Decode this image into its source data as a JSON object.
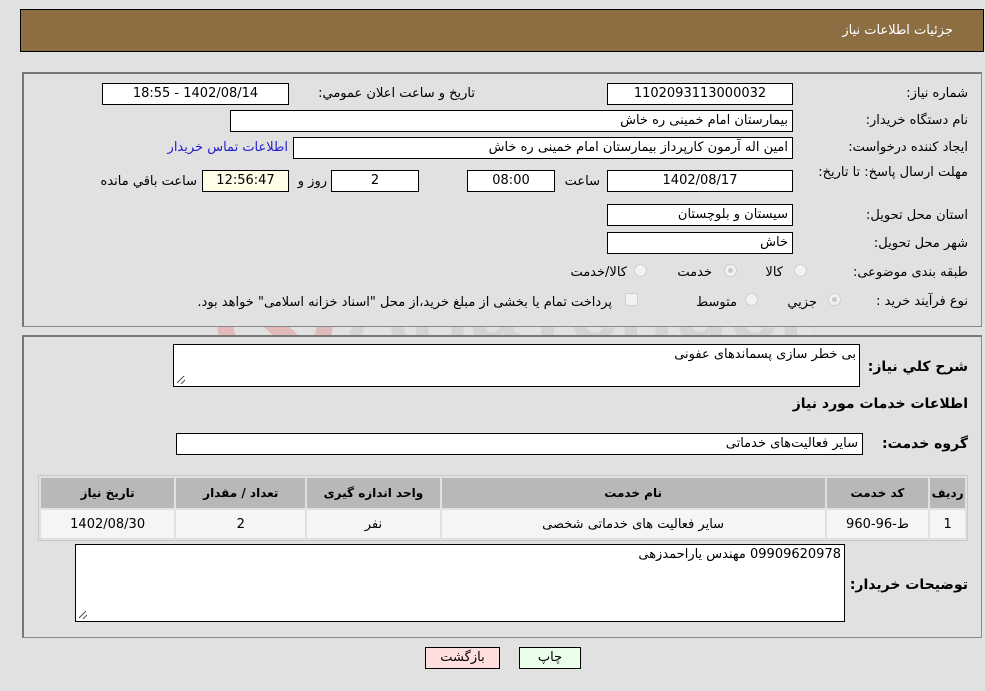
{
  "header": {
    "title": "جزئیات اطلاعات نیاز"
  },
  "form": {
    "need_number": {
      "label": "شماره نیاز:",
      "value": "1102093113000032"
    },
    "announce_datetime": {
      "label": "تاریخ و ساعت اعلان عمومي:",
      "value": "1402/08/14 - 18:55"
    },
    "buyer_org": {
      "label": "نام دستگاه خریدار:",
      "value": "بیمارستان امام خمینی  ره  خاش"
    },
    "requester": {
      "label": "ایجاد کننده درخواست:",
      "value": "امین اله آرمون کارپرداز بیمارستان امام خمینی  ره  خاش"
    },
    "contact_link": "اطلاعات تماس خریدار",
    "deadline": {
      "label": "مهلت ارسال پاسخ: تا تاریخ:",
      "date": "1402/08/17",
      "time_label": "ساعت",
      "time": "08:00",
      "days": "2",
      "days_label": "روز و",
      "remaining": "12:56:47",
      "remaining_label": "ساعت باقي مانده"
    },
    "province": {
      "label": "استان محل تحویل:",
      "value": "سیستان و بلوچستان"
    },
    "city": {
      "label": "شهر محل تحویل:",
      "value": "خاش"
    },
    "category": {
      "label": "طبقه بندی موضوعی:",
      "options": [
        "کالا",
        "خدمت",
        "کالا/خدمت"
      ],
      "selected": "خدمت"
    },
    "process": {
      "label": "نوع فرآیند خرید :",
      "options": [
        "جزيي",
        "متوسط"
      ],
      "selected": "جزيي",
      "treasury_note": "پرداخت تمام یا بخشی از مبلغ خرید،از محل \"اسناد خزانه اسلامی\" خواهد بود."
    }
  },
  "details": {
    "description_label": "شرح کلي نیاز:",
    "description": "بی خطر سازی پسماندهای عفونی",
    "services_heading": "اطلاعات خدمات مورد نیاز",
    "service_group_label": "گروه خدمت:",
    "service_group": "سایر فعالیت‌های خدماتی",
    "table": {
      "headers": [
        "ردیف",
        "کد خدمت",
        "نام خدمت",
        "واحد اندازه گیری",
        "تعداد / مقدار",
        "تاریخ نیاز"
      ],
      "rows": [
        [
          "1",
          "ط-96-960",
          "سایر فعالیت های خدماتی شخصی",
          "نفر",
          "2",
          "1402/08/30"
        ]
      ]
    },
    "buyer_notes_label": "توضیحات خریدار:",
    "buyer_notes": "09909620978 مهندس یاراحمدزهی"
  },
  "buttons": {
    "print": "چاپ",
    "back": "بازگشت"
  },
  "colors": {
    "header_bg": "#8d6e43",
    "print_bg": "#eaffea",
    "back_bg": "#ffdede",
    "remaining_bg": "#fffde7"
  }
}
